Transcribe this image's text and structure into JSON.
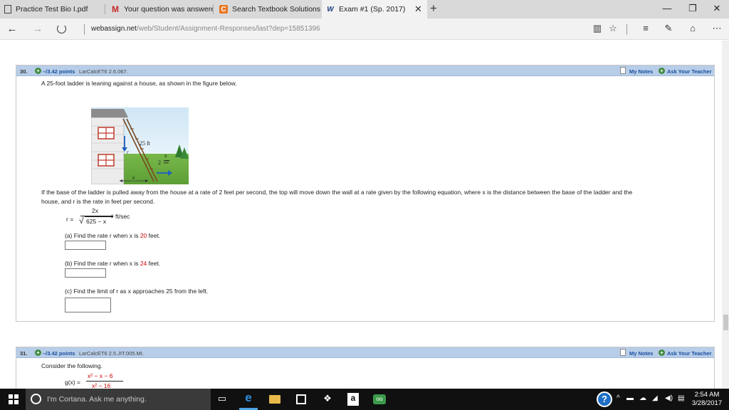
{
  "browser": {
    "tabs": [
      {
        "label": "Practice Test Bio I.pdf",
        "icon": "document-icon"
      },
      {
        "label": "Your question was answere",
        "icon": "gmail-icon"
      },
      {
        "label": "Search Textbook Solutions |",
        "icon": "chegg-icon"
      },
      {
        "label": "Exam #1 (Sp. 2017)",
        "icon": "webassign-icon",
        "active": true
      }
    ],
    "new_tab": "+",
    "close_tab": "✕",
    "window": {
      "minimize": "—",
      "maximize": "❐",
      "close": "✕"
    },
    "url_host": "webassign.net",
    "url_path": "/web/Student/Assignment-Responses/last?dep=15851396"
  },
  "question30": {
    "number": "30.",
    "points": "–/3.42 points",
    "code": "LarCalcET6 2.6.067.",
    "my_notes": "My Notes",
    "ask_teacher": "Ask Your Teacher",
    "prompt": "A 25-foot ladder is leaning against a house, as shown in the figure below.",
    "figure": {
      "ladder_label": "25 ft",
      "rate_num": "ft",
      "rate_coef": "2",
      "rate_den": "sec",
      "r_label": "r",
      "x_label": "x"
    },
    "description_line1": "If the base of the ladder is pulled away from the house at a rate of 2 feet per second, the top will move down the wall at a rate given by the following equation, where x is the distance between the base of the ladder and the",
    "description_line2": "house, and r is the rate in feet per second.",
    "equation": {
      "lhs": "r =",
      "numerator": "2x",
      "denominator": "625 − x",
      "exp": "2",
      "unit": "ft/sec"
    },
    "part_a": {
      "prefix": "(a) Find the rate r when x is ",
      "value": "20",
      "suffix": " feet."
    },
    "part_b": {
      "prefix": "(b) Find the rate r when x is ",
      "value": "24",
      "suffix": " feet."
    },
    "part_c": "(c) Find the limit of r as x approaches 25 from the left."
  },
  "question31": {
    "number": "31.",
    "points": "–/3.42 points",
    "code": "LarCalcET6 2.5.JIT.005.MI.",
    "my_notes": "My Notes",
    "ask_teacher": "Ask Your Teacher",
    "prompt": "Consider the following.",
    "equation": {
      "lhs": "g(x) =",
      "numerator": "x² − x − 6",
      "denominator": "x² − 16"
    }
  },
  "taskbar": {
    "cortana_placeholder": "I'm Cortana. Ask me anything.",
    "time": "2:54 AM",
    "date": "3/28/2017"
  }
}
